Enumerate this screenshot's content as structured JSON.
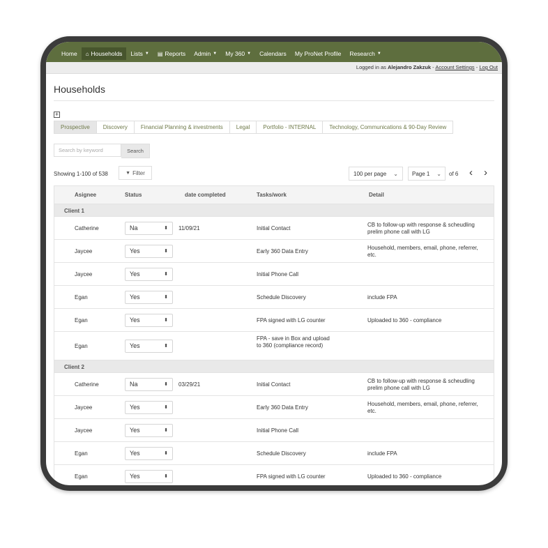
{
  "nav": {
    "items": [
      {
        "label": "Home",
        "icon": "",
        "dropdown": false,
        "active": false
      },
      {
        "label": "Households",
        "icon": "home-icon",
        "dropdown": false,
        "active": true
      },
      {
        "label": "Lists",
        "icon": "",
        "dropdown": true,
        "active": false
      },
      {
        "label": "Reports",
        "icon": "document-icon",
        "dropdown": false,
        "active": false
      },
      {
        "label": "Admin",
        "icon": "",
        "dropdown": true,
        "active": false
      },
      {
        "label": "My 360",
        "icon": "",
        "dropdown": true,
        "active": false
      },
      {
        "label": "Calendars",
        "icon": "",
        "dropdown": false,
        "active": false
      },
      {
        "label": "My ProNet Profile",
        "icon": "",
        "dropdown": false,
        "active": false
      },
      {
        "label": "Research",
        "icon": "",
        "dropdown": true,
        "active": false
      }
    ],
    "color": "#5e6e3e"
  },
  "subbar": {
    "logged_in_prefix": "Logged in as",
    "user": "Alejandro Zakzuk",
    "sep1": " - ",
    "account_settings": "Account Settings",
    "sep2": " - ",
    "logout": "Log Out"
  },
  "page": {
    "title": "Households"
  },
  "tabs": [
    {
      "label": "Prospective",
      "active": true
    },
    {
      "label": "Discovery",
      "active": false
    },
    {
      "label": "Financial Planning & investments",
      "active": false
    },
    {
      "label": "Legal",
      "active": false
    },
    {
      "label": "Portfolio - INTERNAL",
      "active": false
    },
    {
      "label": "Technology, Communications & 90-Day Review",
      "active": false
    }
  ],
  "search": {
    "placeholder": "Search by keyword",
    "button": "Search"
  },
  "toolbar": {
    "showing": "Showing 1-100 of 538",
    "filter": "Filter",
    "per_page": "100 per page",
    "page": "Page 1",
    "of": "of 6"
  },
  "table": {
    "headers": {
      "assignee": "Asignee",
      "status": "Status",
      "date": "date completed",
      "tasks": "Tasks/work",
      "detail": "Detail"
    },
    "groups": [
      {
        "name": "Client 1",
        "rows": [
          {
            "assignee": "Catherine",
            "status": "Na",
            "date": "11/09/21",
            "task": "Initial Contact",
            "detail": "CB to follow-up with response & scheudling prelim phone call with LG"
          },
          {
            "assignee": "Jaycee",
            "status": "Yes",
            "date": "",
            "task": "Early 360 Data Entry",
            "detail": "Household, members, email, phone, referrer, etc."
          },
          {
            "assignee": "Jaycee",
            "status": "Yes",
            "date": "",
            "task": "Initial Phone Call",
            "detail": ""
          },
          {
            "assignee": "Egan",
            "status": "Yes",
            "date": "",
            "task": "Schedule Discovery",
            "detail": "include FPA"
          },
          {
            "assignee": "Egan",
            "status": "Yes",
            "date": "",
            "task": "FPA signed with LG counter",
            "detail": "Uploaded to 360 - compliance"
          },
          {
            "assignee": "Egan",
            "status": "Yes",
            "date": "",
            "task": "FPA - save in Box and upload to 360 (compliance record)",
            "detail": "",
            "tall": true
          }
        ]
      },
      {
        "name": "Client 2",
        "rows": [
          {
            "assignee": "Catherine",
            "status": "Na",
            "date": "03/29/21",
            "task": "Initial Contact",
            "detail": "CB to follow-up with response & scheudling prelim phone call with LG"
          },
          {
            "assignee": "Jaycee",
            "status": "Yes",
            "date": "",
            "task": "Early 360 Data Entry",
            "detail": "Household, members, email, phone, referrer, etc."
          },
          {
            "assignee": "Jaycee",
            "status": "Yes",
            "date": "",
            "task": "Initial Phone Call",
            "detail": ""
          },
          {
            "assignee": "Egan",
            "status": "Yes",
            "date": "",
            "task": "Schedule Discovery",
            "detail": "include FPA"
          },
          {
            "assignee": "Egan",
            "status": "Yes",
            "date": "",
            "task": "FPA signed with LG counter",
            "detail": "Uploaded to 360 - compliance"
          }
        ]
      }
    ]
  }
}
